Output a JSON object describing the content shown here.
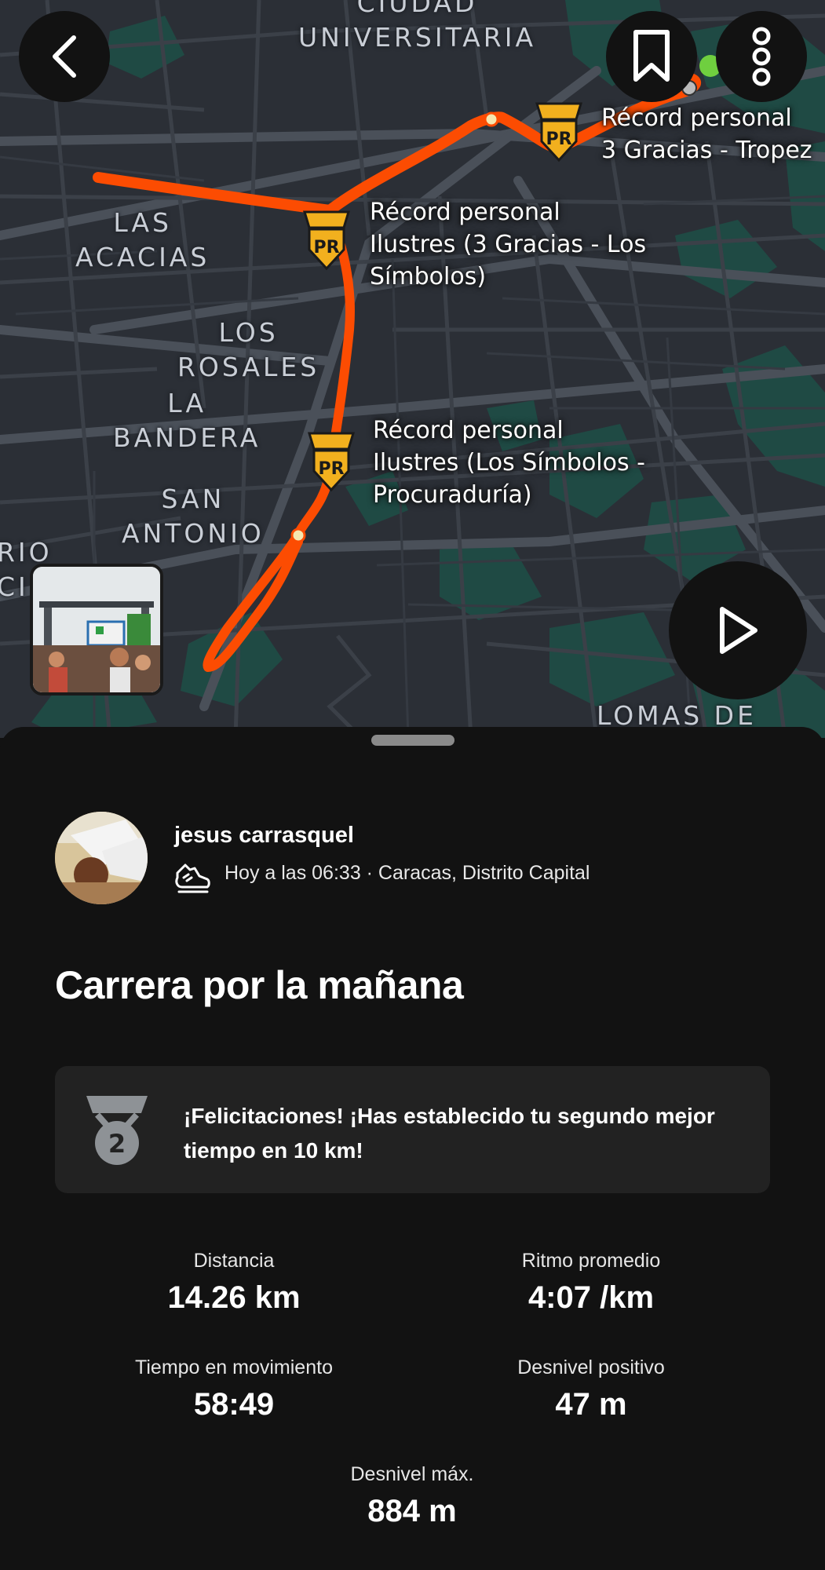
{
  "map": {
    "area_labels": {
      "ciudad_universitaria": [
        "CIUDAD",
        "UNIVERSITARIA"
      ],
      "las_acacias": [
        "LAS",
        "ACACIAS"
      ],
      "los_rosales": [
        "LOS",
        "ROSALES"
      ],
      "la_bandera": [
        "LA",
        "BANDERA"
      ],
      "san_antonio": [
        "SAN",
        "ANTONIO"
      ],
      "rio_partial": [
        "RIO",
        "CI"
      ],
      "lomas_de": "LOMAS DE"
    },
    "segments": [
      {
        "line1": "Récord personal",
        "line2": "3 Gracias - Tropez",
        "badge": "PR"
      },
      {
        "line1": "Récord personal",
        "line2": "Ilustres (3 Gracias - Los",
        "line3": "Símbolos)",
        "badge": "PR"
      },
      {
        "line1": "Récord personal",
        "line2": "Ilustres (Los Símbolos -",
        "line3": "Procuraduría)",
        "badge": "PR"
      }
    ],
    "route_color": "#fc4c02",
    "badge_color": "#f2b01e",
    "buttons": {
      "back": "back-icon",
      "bookmark": "bookmark-icon",
      "more": "more-vertical-icon",
      "play": "play-icon"
    }
  },
  "activity": {
    "athlete": "jesus carrasquel",
    "sport_icon": "shoe-icon",
    "meta": "Hoy a las 06:33 · Caracas, Distrito Capital",
    "title": "Carrera por la mañana"
  },
  "achievement": {
    "medal_rank": "2",
    "text": "¡Felicitaciones! ¡Has establecido tu segundo mejor tiempo en 10 km!"
  },
  "stats": [
    {
      "label": "Distancia",
      "value": "14.26 km"
    },
    {
      "label": "Ritmo promedio",
      "value": "4:07 /km"
    },
    {
      "label": "Tiempo en movimiento",
      "value": "58:49"
    },
    {
      "label": "Desnivel positivo",
      "value": "47 m"
    },
    {
      "label": "Desnivel máx.",
      "value": "884 m"
    }
  ]
}
